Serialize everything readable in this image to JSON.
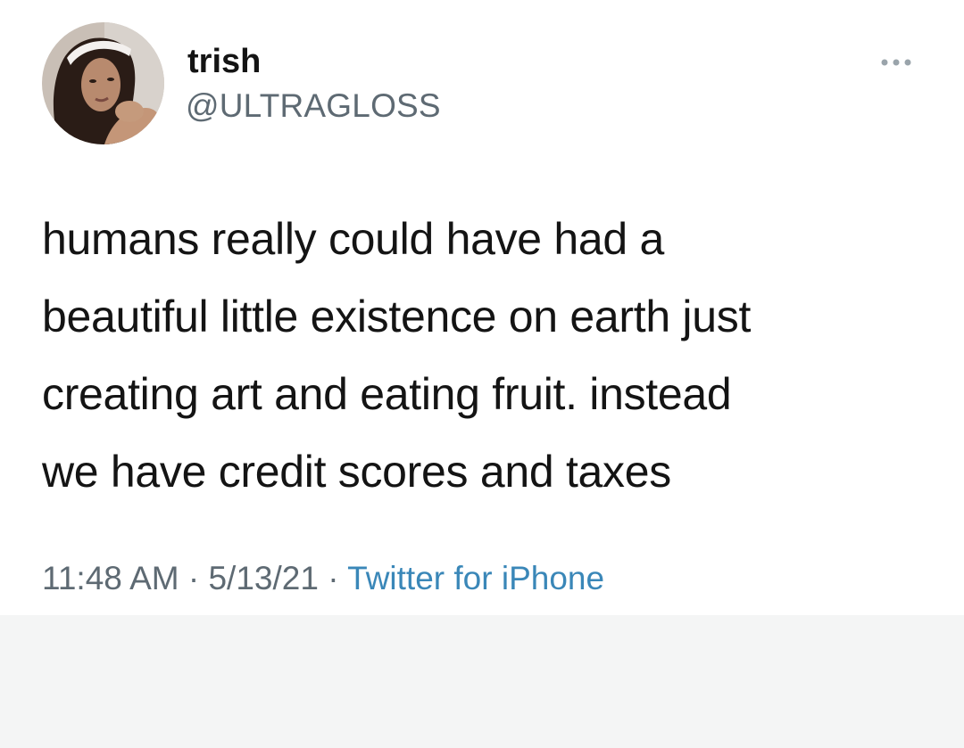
{
  "tweet": {
    "author": {
      "display_name": "trish",
      "handle": "@ULTRAGLOSS",
      "avatar_icon": "profile-photo"
    },
    "more_icon": "ellipsis-icon",
    "text": "humans really could have had a\nbeautiful little existence on earth just\ncreating art and eating fruit. instead\nwe have credit scores and taxes",
    "time": "11:48 AM",
    "separator": " · ",
    "date": "5/13/21",
    "source": "Twitter for iPhone"
  },
  "colors": {
    "background": "#ffffff",
    "text": "#141414",
    "muted": "#5e6a73",
    "link": "#3a87b8",
    "footer_bg": "#f4f5f5"
  }
}
